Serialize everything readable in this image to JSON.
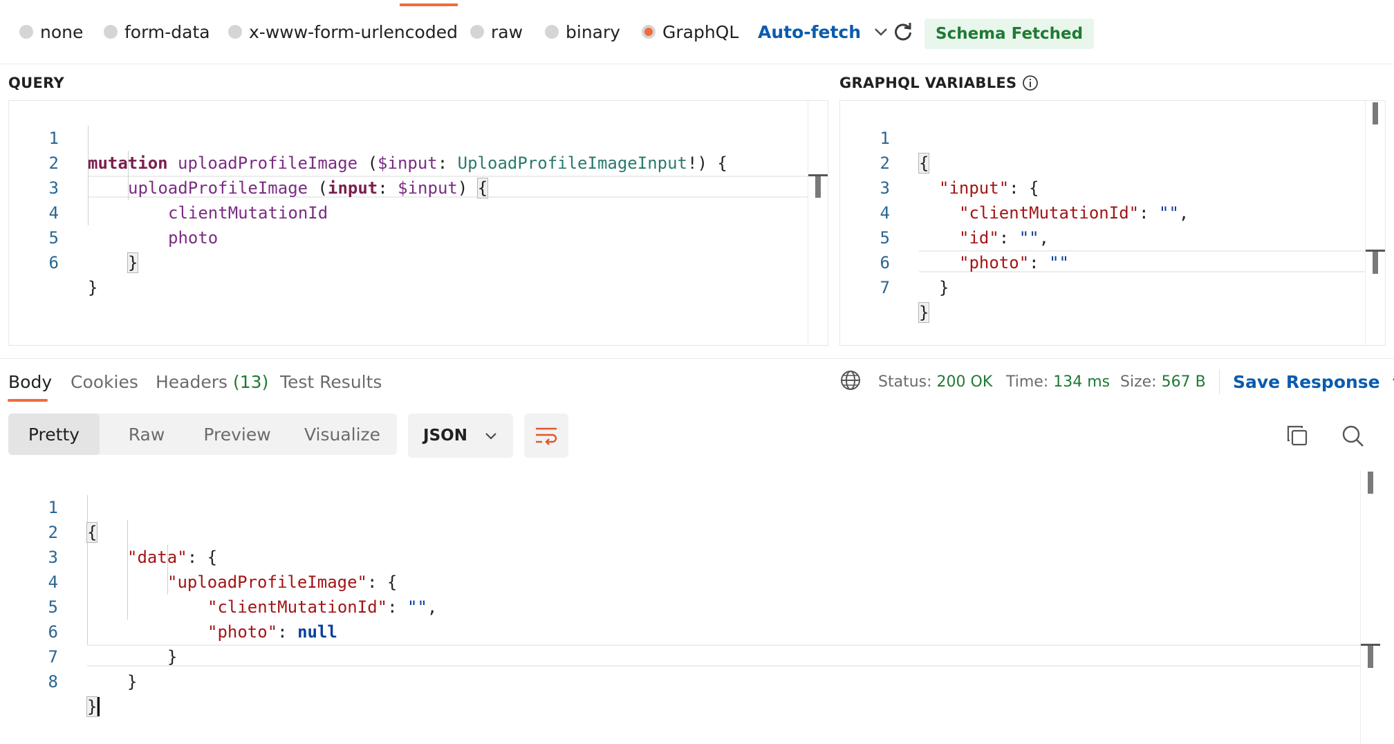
{
  "body_types": [
    {
      "label": "none",
      "selected": false
    },
    {
      "label": "form-data",
      "selected": false
    },
    {
      "label": "x-www-form-urlencoded",
      "selected": false
    },
    {
      "label": "raw",
      "selected": false
    },
    {
      "label": "binary",
      "selected": false
    },
    {
      "label": "GraphQL",
      "selected": true
    }
  ],
  "autofetch_label": "Auto-fetch",
  "schema_status": "Schema Fetched",
  "query": {
    "title": "QUERY",
    "line_numbers": [
      "1",
      "2",
      "3",
      "4",
      "5",
      "6"
    ]
  },
  "variables": {
    "title": "GRAPHQL VARIABLES",
    "line_numbers": [
      "1",
      "2",
      "3",
      "4",
      "5",
      "6",
      "7"
    ]
  },
  "response": {
    "tabs": {
      "body": "Body",
      "cookies": "Cookies",
      "headers": "Headers",
      "headers_count": "(13)",
      "tests": "Test Results"
    },
    "status_label": "Status:",
    "status_value": "200 OK",
    "time_label": "Time:",
    "time_value": "134 ms",
    "size_label": "Size:",
    "size_value": "567 B",
    "save_label": "Save Response",
    "views": {
      "pretty": "Pretty",
      "raw": "Raw",
      "preview": "Preview",
      "visualize": "Visualize"
    },
    "format": "JSON",
    "line_numbers": [
      "1",
      "2",
      "3",
      "4",
      "5",
      "6",
      "7",
      "8"
    ]
  },
  "colors": {
    "accent": "#f26b3a",
    "link": "#0b5cad",
    "success": "#1f7a34"
  }
}
